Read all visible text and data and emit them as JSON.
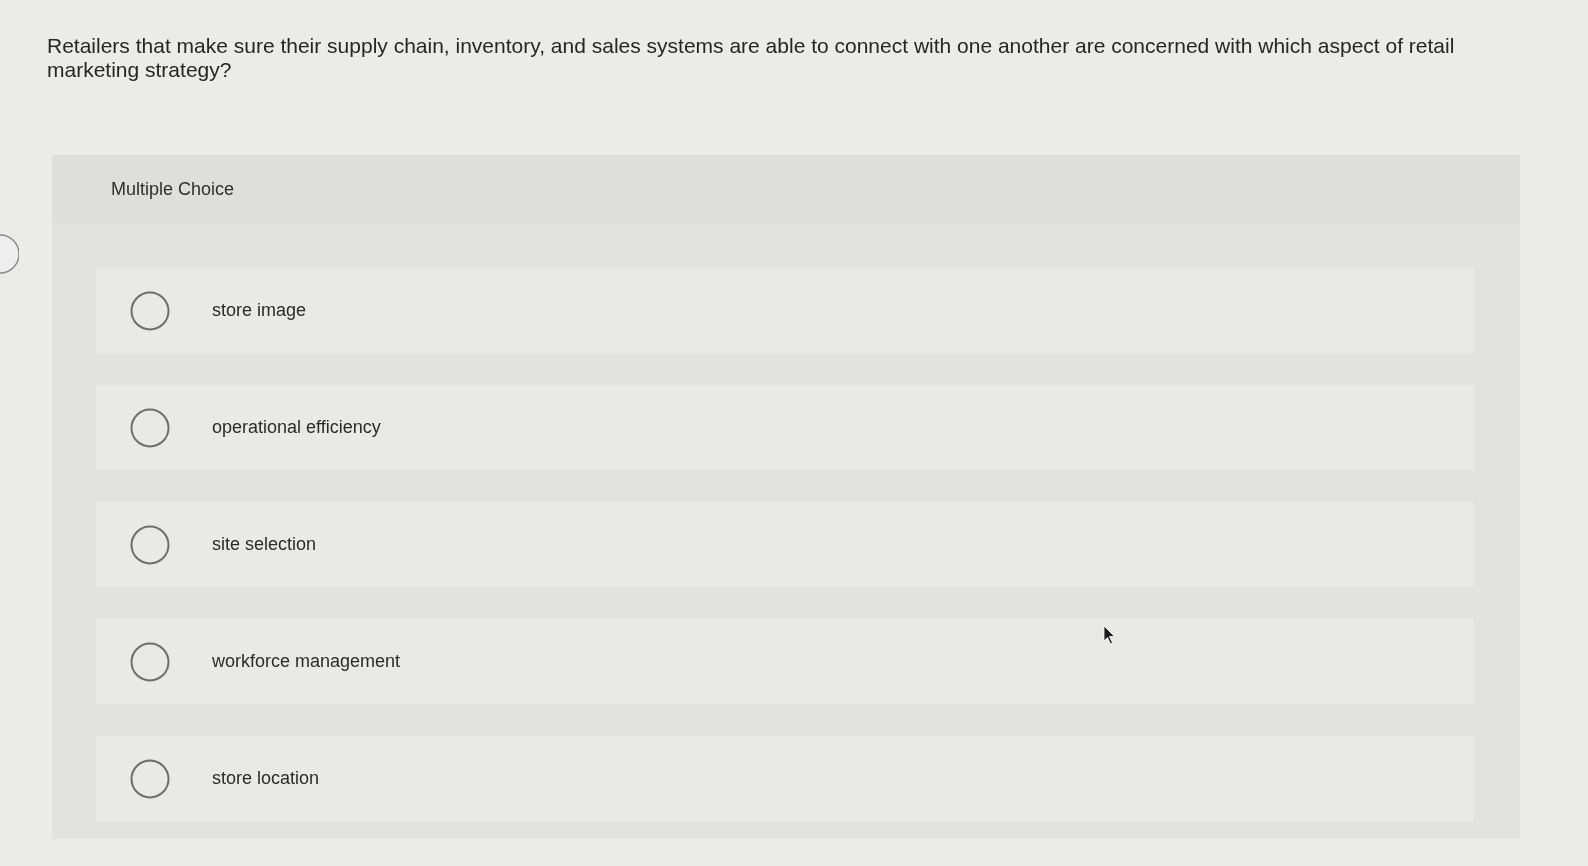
{
  "question": "Retailers that make sure their supply chain, inventory, and sales systems are able to connect with one another are concerned with which aspect of retail marketing strategy?",
  "question_type": "Multiple Choice",
  "options": [
    {
      "label": "store image",
      "selected": false
    },
    {
      "label": "operational efficiency",
      "selected": false
    },
    {
      "label": "site selection",
      "selected": false
    },
    {
      "label": "workforce management",
      "selected": false
    },
    {
      "label": "store location",
      "selected": false
    }
  ]
}
